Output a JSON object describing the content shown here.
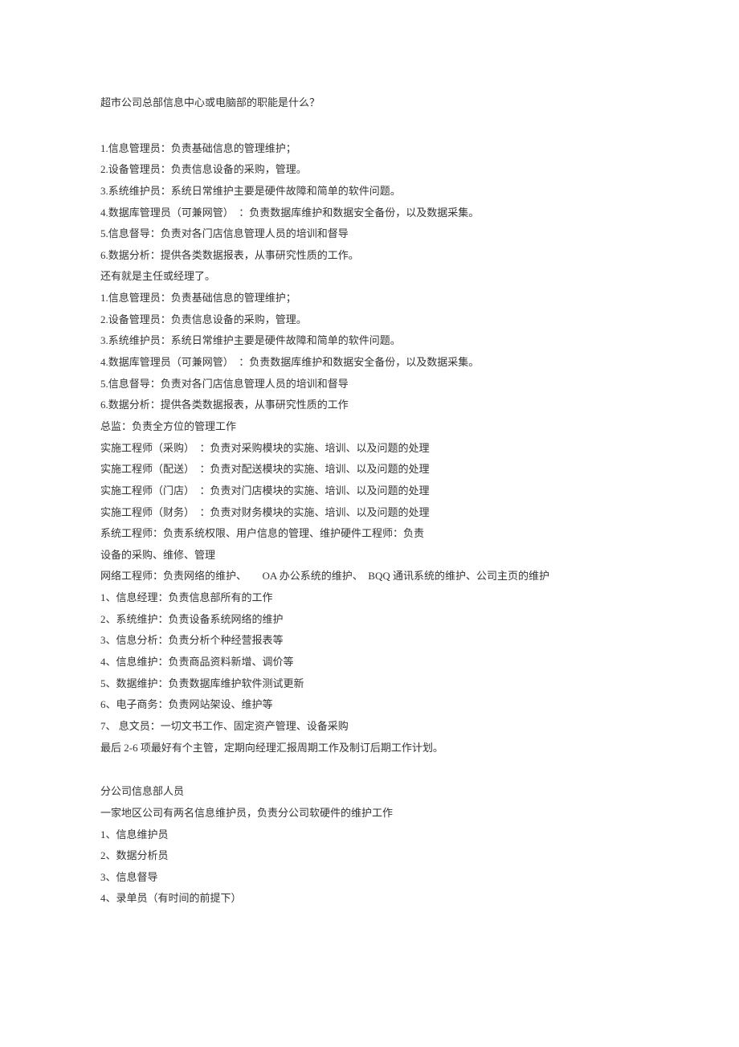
{
  "title": "超市公司总部信息中心或电脑部的职能是什么？",
  "lines": [
    "1.信息管理员：负责基础信息的管理维护；",
    "2.设备管理员：负责信息设备的采购，管理。",
    "3.系统维护员：系统日常维护主要是硬件故障和简单的软件问题。",
    "4.数据库管理员（可兼网管）　：负责数据库维护和数据安全备份，以及数据采集。",
    "5.信息督导：负责对各门店信息管理人员的培训和督导",
    "6.数据分析：提供各类数据报表，从事研究性质的工作。",
    "还有就是主任或经理了。",
    "1.信息管理员：负责基础信息的管理维护；",
    "2.设备管理员：负责信息设备的采购，管理。",
    "3.系统维护员：系统日常维护主要是硬件故障和简单的软件问题。",
    "4.数据库管理员（可兼网管）　：负责数据库维护和数据安全备份，以及数据采集。",
    "5.信息督导：负责对各门店信息管理人员的培训和督导",
    "6.数据分析：提供各类数据报表，从事研究性质的工作",
    "总监：负责全方位的管理工作",
    "实施工程师（采购）　：负责对采购模块的实施、培训、以及问题的处理",
    "实施工程师（配送）　：负责对配送模块的实施、培训、以及问题的处理",
    "实施工程师（门店）　：负责对门店模块的实施、培训、以及问题的处理",
    "实施工程师（财务）　：负责对财务模块的实施、培训、以及问题的处理",
    "系统工程师：负责系统权限、用户信息的管理、维护硬件工程师：负责",
    "设备的采购、维修、管理",
    "网络工程师：负责网络的维护、　　OA 办公系统的维护、　BQQ 通讯系统的维护、公司主页的维护",
    "1、信息经理：负责信息部所有的工作",
    "2、系统维护：负责设备系统网络的维护",
    "3、信息分析：负责分析个种经营报表等",
    "4、信息维护：负责商品资料新增、调价等",
    "5、数据维护：负责数据库维护软件测试更新",
    "6、电子商务：负责网站架设、维护等",
    "7、 息文员：一切文书工作、固定资产管理、设备采购",
    "最后 2-6 项最好有个主管，定期向经理汇报周期工作及制订后期工作计划。"
  ],
  "section2_header": "分公司信息部人员",
  "section2_lines": [
    "一家地区公司有两名信息维护员，负责分公司软硬件的维护工作",
    "1、信息维护员",
    "2、数据分析员",
    "3、信息督导",
    "4、录单员（有时间的前提下）"
  ]
}
